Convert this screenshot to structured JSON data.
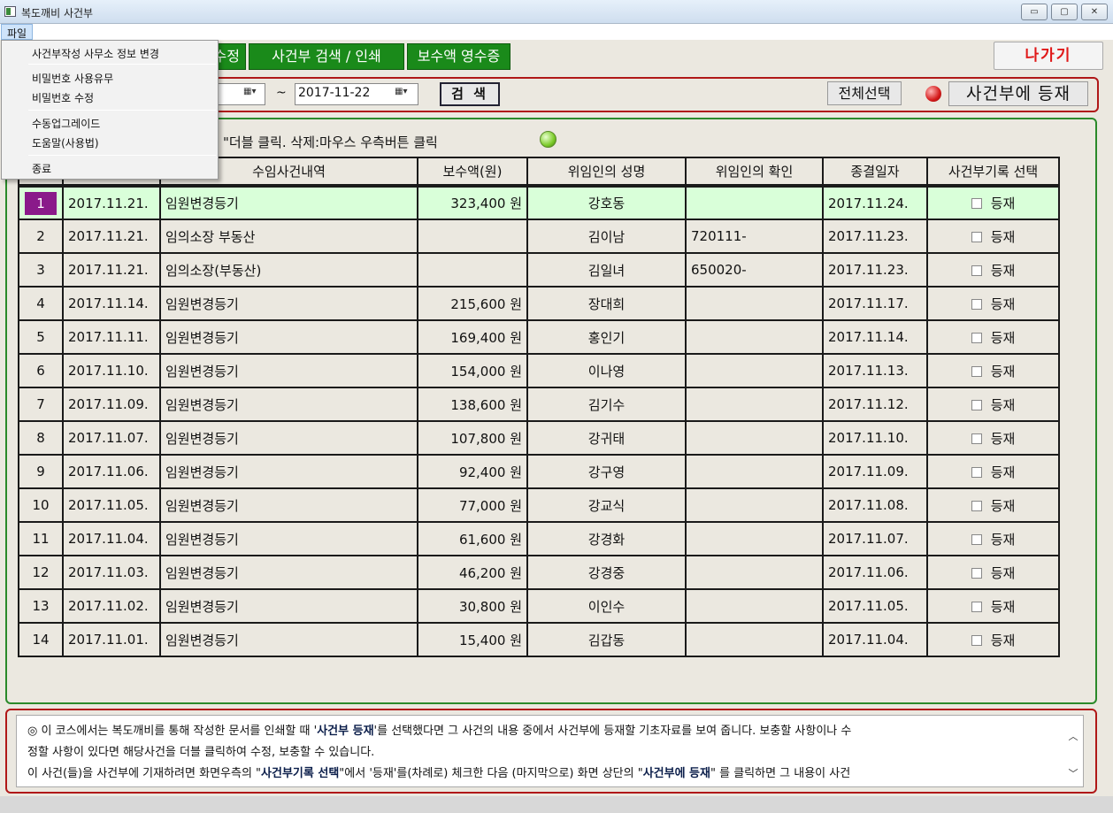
{
  "window": {
    "title": "복도깨비 사건부",
    "minimize": "▭",
    "maximize": "▢",
    "close": "✕"
  },
  "menubar": {
    "file_label": "파일"
  },
  "file_menu": {
    "items": [
      "사건부작성 사무소 정보 변경",
      "비밀번호 사용유무",
      "비밀번호 수정",
      "수동업그레이드",
      "도움말(사용법)",
      "종료"
    ]
  },
  "tabs": [
    "수정",
    "사건부 검색 / 인쇄",
    "보수액 영수증"
  ],
  "exit_label": "나가기",
  "search": {
    "date_to": "2017-11-22",
    "tilde": "~",
    "calendar_glyph": "▦▾",
    "search_label": "검 색",
    "select_all_label": "전체선택",
    "register_label": "사건부에 등재"
  },
  "list": {
    "instruction": "\"더블 클릭. 삭제:마우스 우측버튼 클릭",
    "headers": [
      "",
      "",
      "수임사건내역",
      "보수액(원)",
      "위임인의 성명",
      "위임인의 확인",
      "종결일자",
      "사건부기록 선택"
    ],
    "register_text": "등재",
    "rows": [
      {
        "no": "1",
        "date": "2017.11.21.",
        "case": "임원변경등기",
        "fee": "323,400 원",
        "name": "강호동",
        "confirm": "",
        "end": "2017.11.24."
      },
      {
        "no": "2",
        "date": "2017.11.21.",
        "case": "임의소장 부동산",
        "fee": "",
        "name": "김이남",
        "confirm": "720111-",
        "end": "2017.11.23."
      },
      {
        "no": "3",
        "date": "2017.11.21.",
        "case": "임의소장(부동산)",
        "fee": "",
        "name": "김일녀",
        "confirm": "650020-",
        "end": "2017.11.23."
      },
      {
        "no": "4",
        "date": "2017.11.14.",
        "case": "임원변경등기",
        "fee": "215,600 원",
        "name": "장대희",
        "confirm": "",
        "end": "2017.11.17."
      },
      {
        "no": "5",
        "date": "2017.11.11.",
        "case": "임원변경등기",
        "fee": "169,400 원",
        "name": "홍인기",
        "confirm": "",
        "end": "2017.11.14."
      },
      {
        "no": "6",
        "date": "2017.11.10.",
        "case": "임원변경등기",
        "fee": "154,000 원",
        "name": "이나영",
        "confirm": "",
        "end": "2017.11.13."
      },
      {
        "no": "7",
        "date": "2017.11.09.",
        "case": "임원변경등기",
        "fee": "138,600 원",
        "name": "김기수",
        "confirm": "",
        "end": "2017.11.12."
      },
      {
        "no": "8",
        "date": "2017.11.07.",
        "case": "임원변경등기",
        "fee": "107,800 원",
        "name": "강귀태",
        "confirm": "",
        "end": "2017.11.10."
      },
      {
        "no": "9",
        "date": "2017.11.06.",
        "case": "임원변경등기",
        "fee": "92,400 원",
        "name": "강구영",
        "confirm": "",
        "end": "2017.11.09."
      },
      {
        "no": "10",
        "date": "2017.11.05.",
        "case": "임원변경등기",
        "fee": "77,000 원",
        "name": "강교식",
        "confirm": "",
        "end": "2017.11.08."
      },
      {
        "no": "11",
        "date": "2017.11.04.",
        "case": "임원변경등기",
        "fee": "61,600 원",
        "name": "강경화",
        "confirm": "",
        "end": "2017.11.07."
      },
      {
        "no": "12",
        "date": "2017.11.03.",
        "case": "임원변경등기",
        "fee": "46,200 원",
        "name": "강경중",
        "confirm": "",
        "end": "2017.11.06."
      },
      {
        "no": "13",
        "date": "2017.11.02.",
        "case": "임원변경등기",
        "fee": "30,800 원",
        "name": "이인수",
        "confirm": "",
        "end": "2017.11.05."
      },
      {
        "no": "14",
        "date": "2017.11.01.",
        "case": "임원변경등기",
        "fee": "15,400 원",
        "name": "김갑동",
        "confirm": "",
        "end": "2017.11.04."
      }
    ]
  },
  "info": {
    "l1a": "◎ 이 코스에서는 복도깨비를 통해 작성한 문서를 인쇄할 때 '",
    "l1b": "사건부 등재",
    "l1c": "'를 선택했다면 그 사건의 내용 중에서 사건부에 등재할 기초자료를 보여 줍니다. 보충할 사항이나 수",
    "l2": "정할 사항이 있다면 해당사건을 더블 클릭하여 수정, 보충할 수 있습니다.",
    "l3a": "이 사건(들)을 사건부에 기재하려면 화면우측의 \"",
    "l3b": "사건부기록 선택",
    "l3c": "\"에서 '등재'를(차례로) 체크한 다음 (마지막으로) 화면 상단의 \"",
    "l3d": "사건부에 등재",
    "l3e": "\" 를 클릭하면 그 내용이 사건",
    "scroll_up": "︿",
    "scroll_down": "﹀"
  },
  "colors": {
    "tab_green": "#1a8a1a",
    "panel_red": "#b01818",
    "panel_green": "#2a8a2a",
    "highlight_row": "#d9ffd9",
    "row_badge": "#8a1a8a",
    "exit_red": "#e01818"
  }
}
